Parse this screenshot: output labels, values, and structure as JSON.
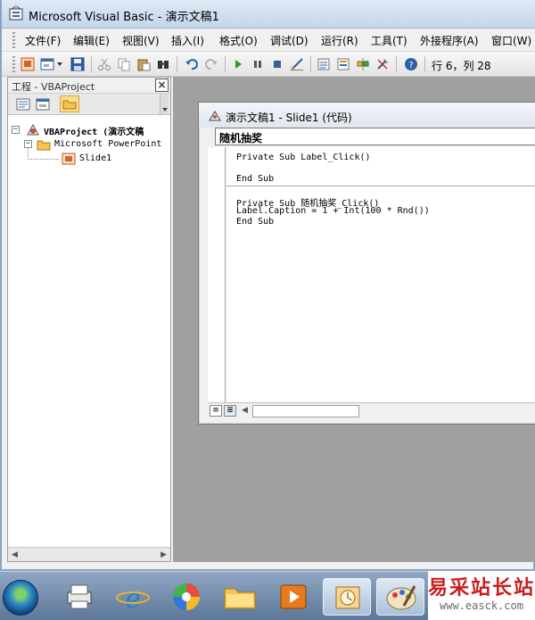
{
  "window": {
    "title": "Microsoft Visual Basic - 演示文稿1"
  },
  "menu": {
    "items": [
      "文件(F)",
      "编辑(E)",
      "视图(V)",
      "插入(I)",
      "格式(O)",
      "调试(D)",
      "运行(R)",
      "工具(T)",
      "外接程序(A)",
      "窗口(W)"
    ]
  },
  "toolbar": {
    "position_text": "行 6，列 28",
    "icons": [
      "view-powerpoint-icon",
      "insert-userform-icon",
      "dropdown-icon",
      "save-icon",
      "cut-icon",
      "copy-icon",
      "paste-icon",
      "find-icon",
      "undo-icon",
      "redo-icon",
      "run-icon",
      "break-icon",
      "reset-icon",
      "design-mode-icon",
      "project-explorer-icon",
      "properties-icon",
      "object-browser-icon",
      "toolbox-icon",
      "help-icon"
    ]
  },
  "project_pane": {
    "title": "工程 - VBAProject",
    "close_label": "×",
    "tree": {
      "root": "VBAProject (演示文稿",
      "folder": "Microsoft PowerPoint",
      "leaf": "Slide1"
    }
  },
  "code_window": {
    "title": "演示文稿1 - Slide1 (代码)",
    "object_name": "随机抽奖",
    "lines_proc1": [
      "Private Sub Label_Click()",
      "",
      "End Sub"
    ],
    "lines_proc2": [
      "Private Sub 随机抽奖_Click()",
      "Label.Caption = 1 + Int(100 * Rnd())",
      "End Sub"
    ]
  },
  "watermark": {
    "text": "易采站长站",
    "url": "www.easck.com"
  },
  "colors": {
    "titlebar": "#c5d6ea",
    "workspace": "#a0a0a0",
    "watermark": "#c81e1e"
  }
}
